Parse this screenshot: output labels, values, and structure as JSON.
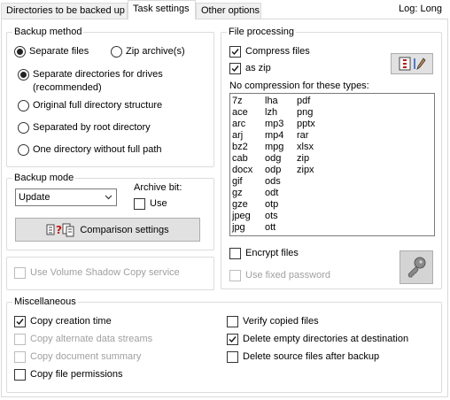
{
  "tabs": [
    {
      "label": "Directories to be backed up"
    },
    {
      "label": "Task settings"
    },
    {
      "label": "Other options"
    }
  ],
  "log_label": "Log: Long",
  "backup_method": {
    "title": "Backup method",
    "separate_files": "Separate files",
    "zip_archives": "Zip archive(s)",
    "opt_drives_line1": "Separate directories for drives",
    "opt_drives_line2": "(recommended)",
    "opt_original": "Original full directory structure",
    "opt_root": "Separated by root directory",
    "opt_one_dir": "One directory without full path"
  },
  "backup_mode": {
    "title": "Backup mode",
    "selected": "Update",
    "archive_bit_label": "Archive bit:",
    "use_label": "Use",
    "comparison_button": "Comparison settings"
  },
  "shadow_copy_label": "Use Volume Shadow Copy service",
  "file_processing": {
    "title": "File processing",
    "compress_files": "Compress files",
    "as_zip": "as zip",
    "no_compression_label": "No compression for these types:",
    "types_col1": [
      "7z",
      "ace",
      "arc",
      "arj",
      "bz2",
      "cab",
      "docx",
      "gif",
      "gz",
      "gze",
      "jpeg",
      "jpg"
    ],
    "types_col2": [
      "lha",
      "lzh",
      "mp3",
      "mp4",
      "mpg",
      "odg",
      "odp",
      "ods",
      "odt",
      "otp",
      "ots",
      "ott"
    ],
    "types_col3": [
      "pdf",
      "png",
      "pptx",
      "rar",
      "xlsx",
      "zip",
      "zipx"
    ],
    "encrypt_files": "Encrypt files",
    "use_fixed_password": "Use fixed password"
  },
  "misc": {
    "title": "Miscellaneous",
    "copy_creation_time": "Copy creation time",
    "copy_alt_streams": "Copy alternate data streams",
    "copy_doc_summary": "Copy document summary",
    "copy_file_permissions": "Copy file permissions",
    "verify_copied": "Verify copied files",
    "delete_empty_dirs": "Delete empty directories at destination",
    "delete_source": "Delete source files after backup"
  }
}
